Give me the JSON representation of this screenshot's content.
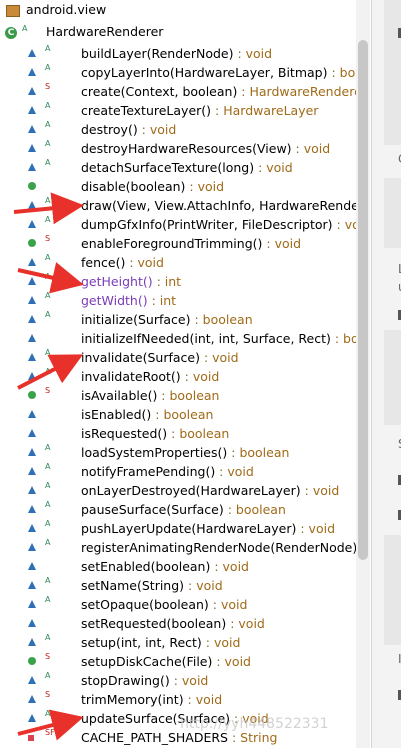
{
  "package": {
    "label": "android.view",
    "icon": "package-icon"
  },
  "class": {
    "label": "HardwareRenderer",
    "icon": "class-icon",
    "modifier": "A"
  },
  "members": [
    {
      "name": "buildLayer(RenderNode)",
      "ret": "void",
      "vis": "tri",
      "mod": "A"
    },
    {
      "name": "copyLayerInto(HardwareLayer, Bitmap)",
      "ret": "boolea",
      "vis": "tri",
      "mod": "A"
    },
    {
      "name": "create(Context, boolean)",
      "ret": "HardwareRenderer",
      "vis": "tri",
      "mod": "S"
    },
    {
      "name": "createTextureLayer()",
      "ret": "HardwareLayer",
      "vis": "tri",
      "mod": "A"
    },
    {
      "name": "destroy()",
      "ret": "void",
      "vis": "tri",
      "mod": "A"
    },
    {
      "name": "destroyHardwareResources(View)",
      "ret": "void",
      "vis": "tri",
      "mod": "A"
    },
    {
      "name": "detachSurfaceTexture(long)",
      "ret": "void",
      "vis": "tri",
      "mod": "A"
    },
    {
      "name": "disable(boolean)",
      "ret": "void",
      "vis": "dot",
      "mod": ""
    },
    {
      "name": "draw(View, View.AttachInfo, HardwareRendere",
      "ret": "",
      "vis": "tri",
      "mod": "A"
    },
    {
      "name": "dumpGfxInfo(PrintWriter, FileDescriptor)",
      "ret": "void",
      "vis": "tri",
      "mod": "A"
    },
    {
      "name": "enableForegroundTrimming()",
      "ret": "void",
      "vis": "dot",
      "mod": "S"
    },
    {
      "name": "fence()",
      "ret": "void",
      "vis": "tri",
      "mod": "A"
    },
    {
      "name": "getHeight()",
      "ret": "int",
      "vis": "tri",
      "mod": "A",
      "purple": true
    },
    {
      "name": "getWidth()",
      "ret": "int",
      "vis": "tri",
      "mod": "A",
      "purple": true
    },
    {
      "name": "initialize(Surface)",
      "ret": "boolean",
      "vis": "tri",
      "mod": "A"
    },
    {
      "name": "initializeIfNeeded(int, int, Surface, Rect)",
      "ret": "boole",
      "vis": "tri",
      "mod": ""
    },
    {
      "name": "invalidate(Surface)",
      "ret": "void",
      "vis": "tri",
      "mod": "A"
    },
    {
      "name": "invalidateRoot()",
      "ret": "void",
      "vis": "tri",
      "mod": "A"
    },
    {
      "name": "isAvailable()",
      "ret": "boolean",
      "vis": "dot",
      "mod": "S"
    },
    {
      "name": "isEnabled()",
      "ret": "boolean",
      "vis": "tri",
      "mod": ""
    },
    {
      "name": "isRequested()",
      "ret": "boolean",
      "vis": "tri",
      "mod": ""
    },
    {
      "name": "loadSystemProperties()",
      "ret": "boolean",
      "vis": "tri",
      "mod": "A"
    },
    {
      "name": "notifyFramePending()",
      "ret": "void",
      "vis": "tri",
      "mod": "A"
    },
    {
      "name": "onLayerDestroyed(HardwareLayer)",
      "ret": "void",
      "vis": "tri",
      "mod": "A"
    },
    {
      "name": "pauseSurface(Surface)",
      "ret": "boolean",
      "vis": "tri",
      "mod": "A"
    },
    {
      "name": "pushLayerUpdate(HardwareLayer)",
      "ret": "void",
      "vis": "tri",
      "mod": "A"
    },
    {
      "name": "registerAnimatingRenderNode(RenderNode)",
      "ret": "v",
      "vis": "tri",
      "mod": "A"
    },
    {
      "name": "setEnabled(boolean)",
      "ret": "void",
      "vis": "tri",
      "mod": ""
    },
    {
      "name": "setName(String)",
      "ret": "void",
      "vis": "tri",
      "mod": "A"
    },
    {
      "name": "setOpaque(boolean)",
      "ret": "void",
      "vis": "tri",
      "mod": "A"
    },
    {
      "name": "setRequested(boolean)",
      "ret": "void",
      "vis": "tri",
      "mod": ""
    },
    {
      "name": "setup(int, int, Rect)",
      "ret": "void",
      "vis": "tri",
      "mod": "A"
    },
    {
      "name": "setupDiskCache(File)",
      "ret": "void",
      "vis": "dot",
      "mod": "S"
    },
    {
      "name": "stopDrawing()",
      "ret": "void",
      "vis": "tri",
      "mod": "A"
    },
    {
      "name": "trimMemory(int)",
      "ret": "void",
      "vis": "tri",
      "mod": "S"
    },
    {
      "name": "updateSurface(Surface)",
      "ret": "void",
      "vis": "tri",
      "mod": "A"
    },
    {
      "name": "CACHE_PATH_SHADERS",
      "ret": "String",
      "vis": "sq",
      "mod": "SF"
    }
  ],
  "right_panel": {
    "letters": [
      "C",
      "L",
      "u",
      "S",
      "I"
    ]
  },
  "watermark": "http://yyh448522331",
  "colors": {
    "arrow": "#e8312b",
    "public": "#2f6fb5",
    "return_type": "#a06a18"
  }
}
